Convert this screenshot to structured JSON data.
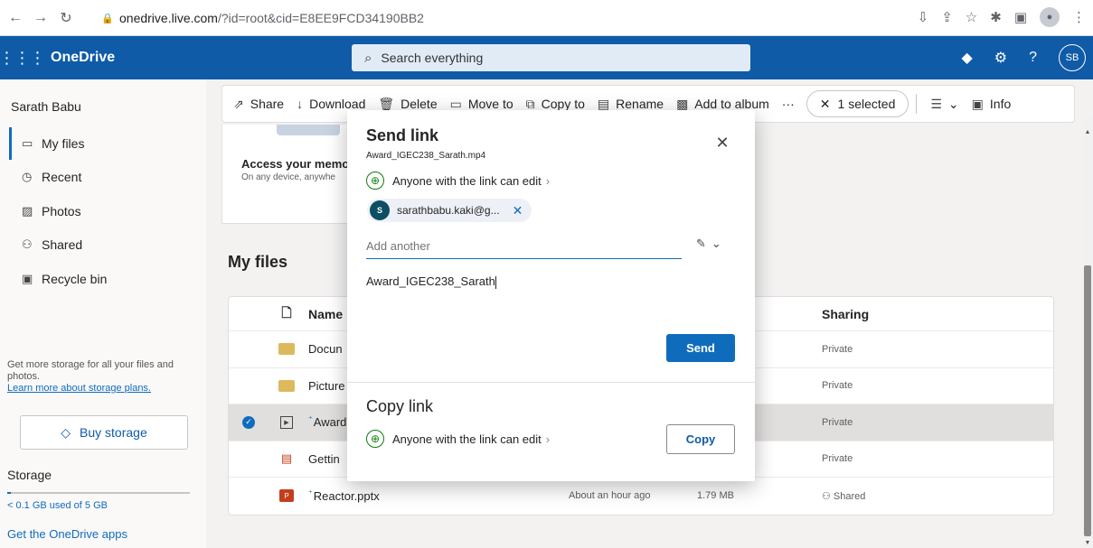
{
  "browser": {
    "url_domain": "onedrive.live.com",
    "url_path": "/?id=root&cid=E8EE9FCD34190BB2"
  },
  "header": {
    "app_name": "OneDrive",
    "search_placeholder": "Search everything",
    "user_initials": "SB"
  },
  "sidebar": {
    "user_name": "Sarath Babu",
    "items": [
      {
        "label": "My files",
        "icon": "folder-icon",
        "active": true
      },
      {
        "label": "Recent",
        "icon": "clock-icon"
      },
      {
        "label": "Photos",
        "icon": "image-icon"
      },
      {
        "label": "Shared",
        "icon": "people-icon"
      },
      {
        "label": "Recycle bin",
        "icon": "recycle-bin-icon"
      }
    ],
    "storage_promo": "Get more storage for all your files and photos.",
    "storage_link": "Learn more about storage plans.",
    "buy_storage": "Buy storage",
    "storage_title": "Storage",
    "storage_used": "< 0.1 GB used of 5 GB",
    "storage_fraction": 0.02,
    "get_apps": "Get the OneDrive apps"
  },
  "toolbar": {
    "share": "Share",
    "download": "Download",
    "delete": "Delete",
    "move_to": "Move to",
    "copy_to": "Copy to",
    "rename": "Rename",
    "add_to_album": "Add to album",
    "more": "···",
    "selected": "1 selected",
    "info": "Info"
  },
  "banner": {
    "title": "Access your memor",
    "subtitle": "On any device, anywhe"
  },
  "main": {
    "section_title": "My files",
    "columns": {
      "name": "Name",
      "sharing": "Sharing"
    },
    "files": [
      {
        "name": "Docun",
        "modified": "",
        "size": "",
        "sharing": "Private",
        "type": "folder"
      },
      {
        "name": "Picture",
        "modified": "",
        "size": "",
        "sharing": "Private",
        "type": "folder"
      },
      {
        "name": "Award",
        "modified": "",
        "size": "",
        "sharing": "Private",
        "type": "video",
        "selected": true
      },
      {
        "name": "Gettin",
        "modified": "",
        "size": "",
        "sharing": "Private",
        "type": "pdf"
      },
      {
        "name": "Reactor.pptx",
        "modified": "About an hour ago",
        "size": "1.79 MB",
        "sharing": "Shared",
        "type": "pptx"
      }
    ]
  },
  "dialog": {
    "title": "Send link",
    "filename": "Award_IGEC238_Sarath.mp4",
    "permission": "Anyone with the link can edit",
    "recipient_initial": "S",
    "recipient": "sarathbabu.kaki@g...",
    "add_placeholder": "Add another",
    "message": "Award_IGEC238_Sarath",
    "send": "Send",
    "copy_title": "Copy link",
    "copy_permission": "Anyone with the link can edit",
    "copy": "Copy"
  },
  "colors": {
    "header_bg": "#0f5ba8",
    "accent": "#0f6cbd",
    "globe": "#107c10"
  }
}
